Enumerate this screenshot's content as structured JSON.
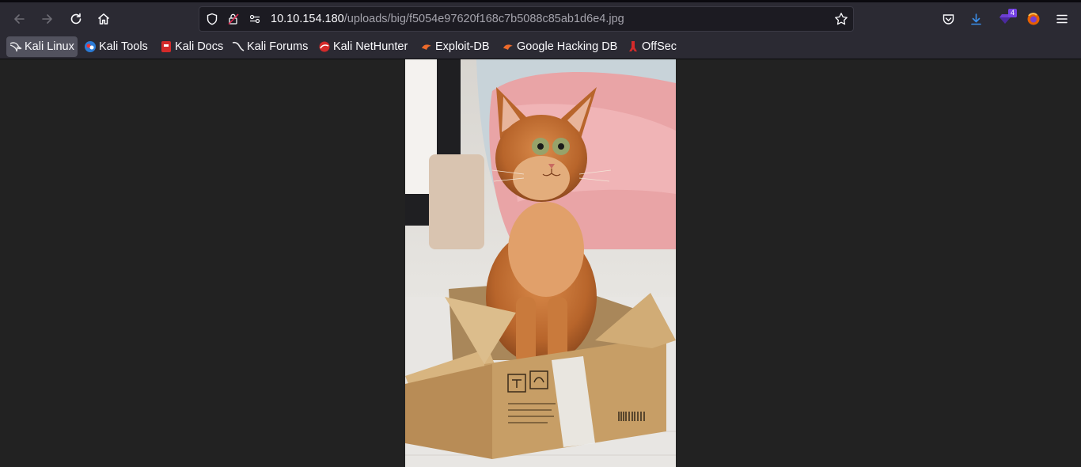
{
  "browser": {
    "url_host": "10.10.154.180",
    "url_path": "/uploads/big/f5054e97620f168c7b5088c85ab1d6e4.jpg",
    "downloads_badge": "4"
  },
  "bookmarks": [
    {
      "label": "Kali Linux",
      "icon": "kali-dragon-icon"
    },
    {
      "label": "Kali Tools",
      "icon": "kali-tools-icon"
    },
    {
      "label": "Kali Docs",
      "icon": "kali-docs-icon"
    },
    {
      "label": "Kali Forums",
      "icon": "kali-forums-icon"
    },
    {
      "label": "Kali NetHunter",
      "icon": "nethunter-icon"
    },
    {
      "label": "Exploit-DB",
      "icon": "exploit-db-icon"
    },
    {
      "label": "Google Hacking DB",
      "icon": "ghdb-icon"
    },
    {
      "label": "OffSec",
      "icon": "offsec-icon"
    }
  ],
  "colors": {
    "toolbar": "#2b2a33",
    "content_bg": "#222222",
    "accent": "#0060df"
  }
}
